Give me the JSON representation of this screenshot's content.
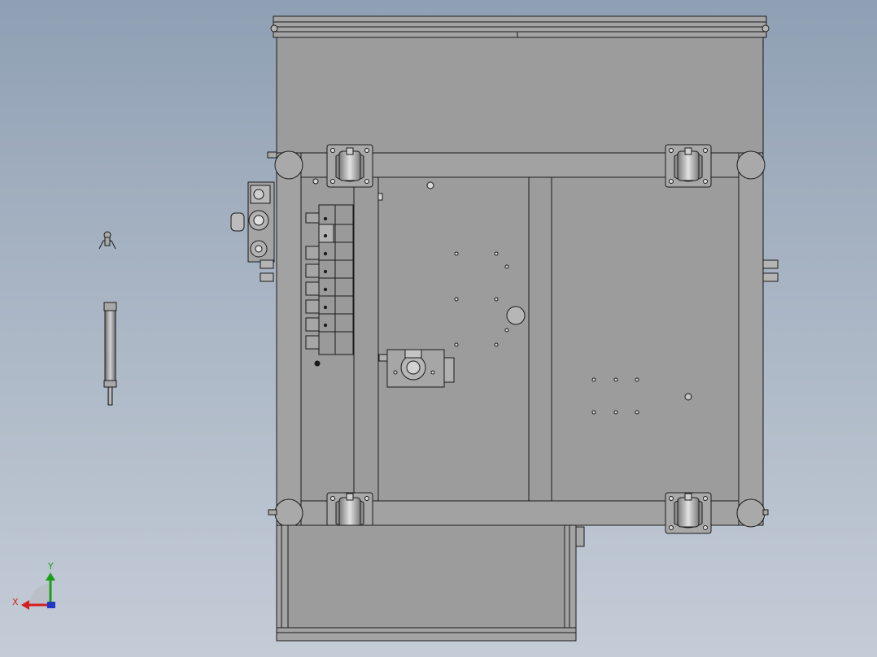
{
  "viewport": {
    "background_top": "#8fa0b4",
    "background_bottom": "#c4ccd7"
  },
  "model": {
    "body_color": "#9c9c9c",
    "edge_color": "#1a1a1a",
    "caster_count": 4,
    "valve_count": 7
  },
  "triad": {
    "x_label": "X",
    "y_label": "Y",
    "x_color": "#d42020",
    "y_color": "#19a019",
    "z_color": "#1f36c8"
  }
}
